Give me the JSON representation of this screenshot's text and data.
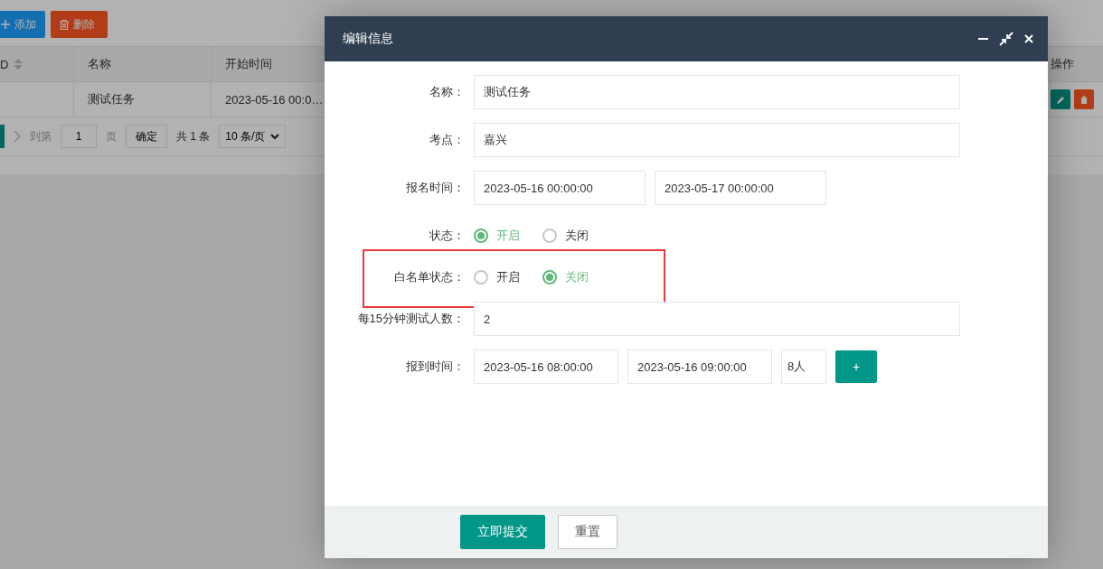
{
  "toolbar": {
    "buttons": [
      {
        "label": "添加",
        "kind": "add"
      },
      {
        "label": "删除",
        "kind": "delete"
      }
    ]
  },
  "table": {
    "columns": [
      "D",
      "名称",
      "开始时间",
      "操作"
    ],
    "rows": [
      {
        "cells": [
          "",
          "测试任务",
          "2023-05-16 00:0…"
        ]
      }
    ]
  },
  "pagination": {
    "goto_label": "到第",
    "page": "1",
    "page_unit": "页",
    "confirm": "确定",
    "total": "共 1 条",
    "page_size": "10 条/页"
  },
  "dialog": {
    "title": "编辑信息",
    "fields": [
      {
        "kind": "text",
        "label": "名称：",
        "values": [
          "测试任务"
        ]
      },
      {
        "kind": "text",
        "label": "考点：",
        "values": [
          "嘉兴"
        ]
      },
      {
        "kind": "range",
        "label": "报名时间：",
        "values": [
          "2023-05-16 00:00:00",
          "2023-05-17 00:00:00"
        ]
      },
      {
        "kind": "radio",
        "label": "状态：",
        "highlighted": false,
        "options": [
          {
            "label": "开启",
            "selected": true
          },
          {
            "label": "关闭",
            "selected": false
          }
        ]
      },
      {
        "kind": "radio",
        "label": "白名单状态：",
        "highlighted": true,
        "options": [
          {
            "label": "开启",
            "selected": false
          },
          {
            "label": "关闭",
            "selected": true
          }
        ]
      },
      {
        "kind": "text",
        "label": "每15分钟测试人数：",
        "values": [
          "2"
        ]
      },
      {
        "kind": "slot",
        "label": "报到时间：",
        "values": [
          "2023-05-16 08:00:00",
          "2023-05-16 09:00:00"
        ],
        "count": "8人",
        "add": "+"
      }
    ],
    "buttons": [
      {
        "label": "立即提交",
        "kind": "primary"
      },
      {
        "label": "重置",
        "kind": "secondary"
      }
    ]
  }
}
